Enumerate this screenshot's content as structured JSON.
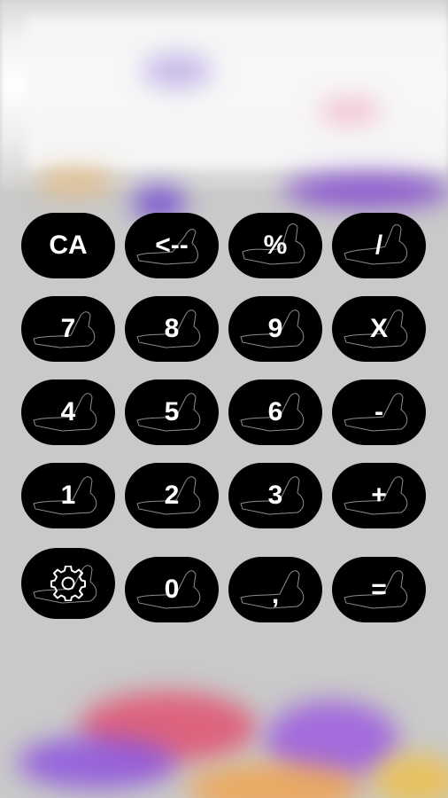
{
  "keys": {
    "clear": "CA",
    "backspace": "<--",
    "percent": "%",
    "divide": "/",
    "seven": "7",
    "eight": "8",
    "nine": "9",
    "multiply": "X",
    "four": "4",
    "five": "5",
    "six": "6",
    "minus": "-",
    "one": "1",
    "two": "2",
    "three": "3",
    "plus": "+",
    "zero": "0",
    "decimal": ",",
    "equals": "="
  },
  "icons": {
    "settings": "gear-icon"
  }
}
